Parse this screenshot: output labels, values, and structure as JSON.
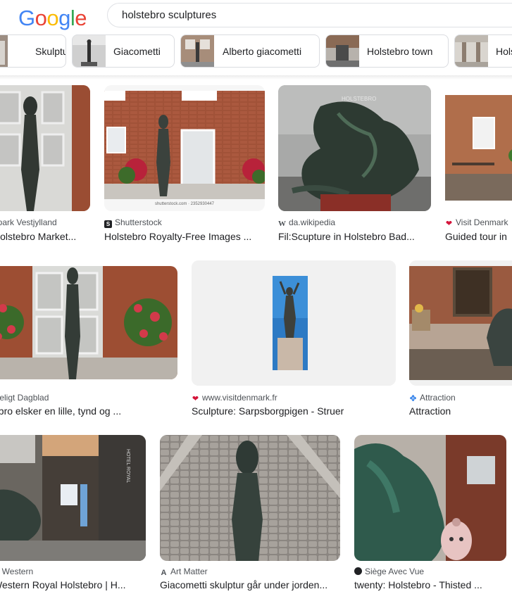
{
  "logo": {
    "letters": [
      "G",
      "o",
      "o",
      "g",
      "l",
      "e"
    ],
    "colors": [
      "#4285F4",
      "#EA4335",
      "#FBBC05",
      "#4285F4",
      "#34A853",
      "#EA4335"
    ]
  },
  "search": {
    "query": "holstebro sculptures"
  },
  "chips": [
    {
      "label": "Skulptur"
    },
    {
      "label": "Giacometti"
    },
    {
      "label": "Alberto giacometti"
    },
    {
      "label": "Holstebro town"
    },
    {
      "label": "Hols"
    }
  ],
  "results": [
    {
      "source": "opark Vestjylland",
      "title": "Holstebro Market...",
      "icon": "globe-icon"
    },
    {
      "source": "Shutterstock",
      "title": "Holstebro Royalty-Free Images ...",
      "icon": "shutterstock-icon"
    },
    {
      "source": "da.wikipedia",
      "title": "Fil:Scupture in Holstebro Bad...",
      "icon": "wikipedia-icon"
    },
    {
      "source": "Visit Denmark",
      "title": "Guided tour in",
      "icon": "heart-icon"
    },
    {
      "source": "steligt Dagblad",
      "title": "ebro elsker en lille, tynd og ...",
      "icon": "globe-icon"
    },
    {
      "source": "www.visitdenmark.fr",
      "title": "Sculpture: Sarpsborgpigen - Struer",
      "icon": "heart-icon"
    },
    {
      "source": "Attraction",
      "title": "Attraction",
      "icon": "attraction-icon"
    },
    {
      "source": "st Western",
      "title": "Western Royal Holstebro | H...",
      "icon": "globe-icon"
    },
    {
      "source": "Art Matter",
      "title": "Giacometti skulptur går under jorden...",
      "icon": "art-matter-icon"
    },
    {
      "source": "Siège Avec Vue",
      "title": "twenty: Holstebro - Thisted ...",
      "icon": "siege-icon"
    }
  ],
  "shutterstock_watermark": "shutterstock.com · 2352930447",
  "wiki_sign": "HOLSTEBRO",
  "hotel_sign": "HOTEL ROYAL"
}
